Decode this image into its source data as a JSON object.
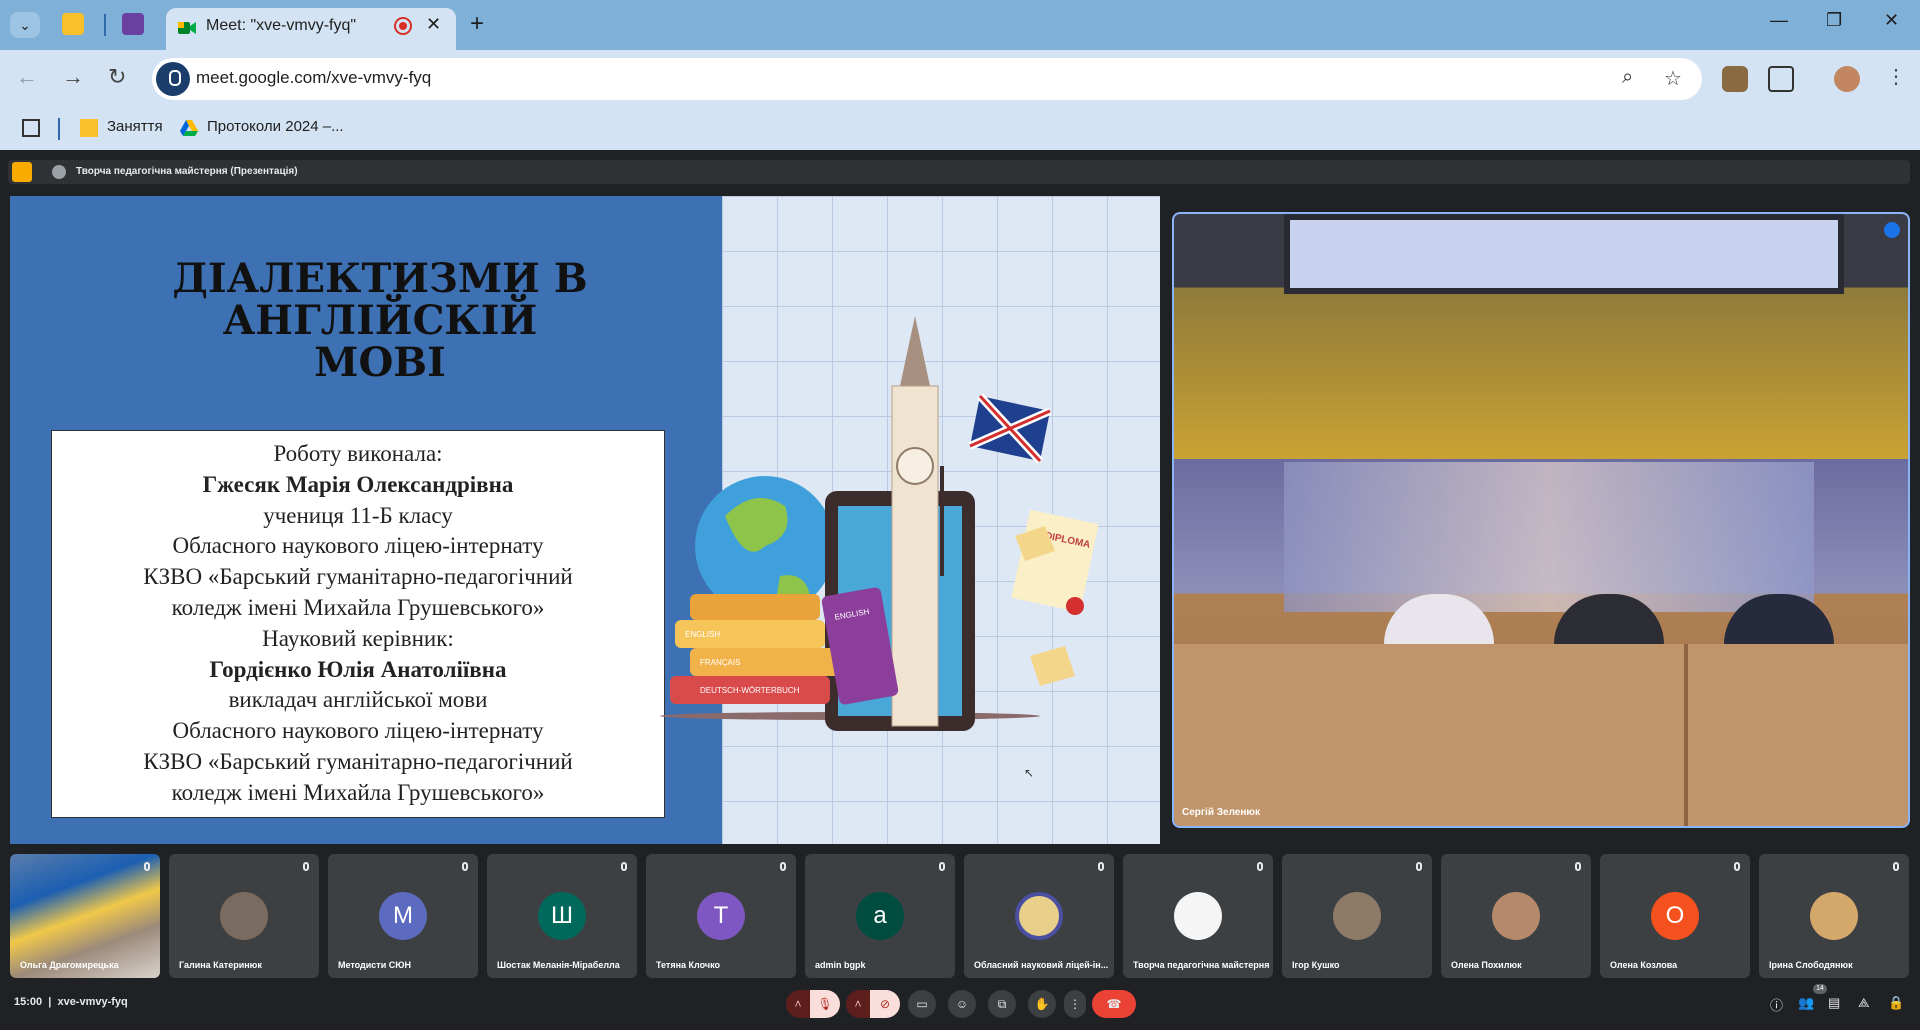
{
  "browser": {
    "tab_title": "Meet: \"xve-vmvy-fyq\"",
    "url": "meet.google.com/xve-vmvy-fyq",
    "bookmarks": [
      {
        "label": "Заняття"
      },
      {
        "label": "Протоколи 2024 –..."
      }
    ]
  },
  "meet": {
    "presenter_label": "Творча педагогічна майстерня (Презентація)",
    "meeting_code": "xve-vmvy-fyq",
    "time": "15:00",
    "participant_count": "14",
    "main_video_name": "Сергій Зеленюк",
    "participants": [
      {
        "name": "Ольга Драгомирецька",
        "initial": "",
        "color": ""
      },
      {
        "name": "Галина Катеринюк",
        "initial": "",
        "color": "#7a6b60"
      },
      {
        "name": "Методисти СЮН",
        "initial": "М",
        "color": "#5c6bc0"
      },
      {
        "name": "Шостак Меланія-Мірабелла",
        "initial": "Ш",
        "color": "#00695c"
      },
      {
        "name": "Тетяна Клочко",
        "initial": "T",
        "color": "#7e57c2"
      },
      {
        "name": "admin bgpk",
        "initial": "a",
        "color": "#004d40"
      },
      {
        "name": "Обласний науковий ліцей-ін...",
        "initial": "",
        "color": "#e8d08a"
      },
      {
        "name": "Творча педагогічна майстерня",
        "initial": "",
        "color": "#f5f5f5"
      },
      {
        "name": "Ігор Кушко",
        "initial": "",
        "color": "#8d7b68"
      },
      {
        "name": "Олена Похилюк",
        "initial": "",
        "color": "#b58a6a"
      },
      {
        "name": "Олена Козлова",
        "initial": "O",
        "color": "#f4511e"
      },
      {
        "name": "Ірина Слободянюк",
        "initial": "",
        "color": "#d4a86a"
      }
    ]
  },
  "slide": {
    "title_lines": [
      "ДІАЛЕКТИЗМИ В",
      "АНГЛІЙСКІЙ",
      "МОВІ"
    ],
    "box_lines": [
      "Роботу виконала:",
      "Гжесяк Марія Олександрівна",
      "учениця 11-Б класу",
      "Обласного наукового ліцею-інтернату",
      "КЗВО «Барський гуманітарно-педагогічний",
      "коледж імені Михайла Грушевського»",
      "Науковий керівник:",
      "Гордієнко Юлія Анатоліївна",
      "викладач англійської мови",
      "Обласного наукового ліцею-інтернату",
      "КЗВО «Барський гуманітарно-педагогічний",
      "коледж імені Михайла Грушевського»"
    ],
    "illustration_labels": {
      "diploma": "DIPLOMA",
      "book1": "ENGLISH",
      "book2": "FRANÇAIS",
      "book3": "DEUTSCH-WÖRTERBUCH",
      "book4": "ENGLISH"
    }
  }
}
